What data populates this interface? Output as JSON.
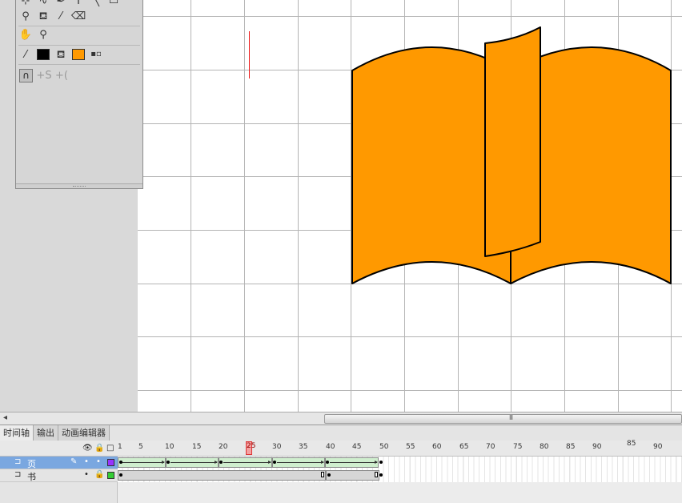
{
  "timeline": {
    "tabs": [
      "时间轴",
      "输出",
      "动画编辑器"
    ],
    "ruler_labels": [
      "1",
      "5",
      "10",
      "15",
      "20",
      "25",
      "30",
      "35",
      "40",
      "45",
      "50",
      "55",
      "60",
      "65",
      "70",
      "75",
      "80",
      "85",
      "90"
    ],
    "extra_labels": [
      "85",
      "90"
    ],
    "playhead_frame": "25",
    "layers": [
      {
        "name": "页",
        "color": "#9933ff",
        "selected": true
      },
      {
        "name": "书",
        "color": "#33cc33",
        "selected": false
      }
    ]
  },
  "colors": {
    "fill": "#ff9900",
    "stroke": "#000000",
    "grid": "#b4b4b4"
  },
  "tools": {
    "stroke_color": "#000000",
    "fill_color": "#ff9900"
  }
}
